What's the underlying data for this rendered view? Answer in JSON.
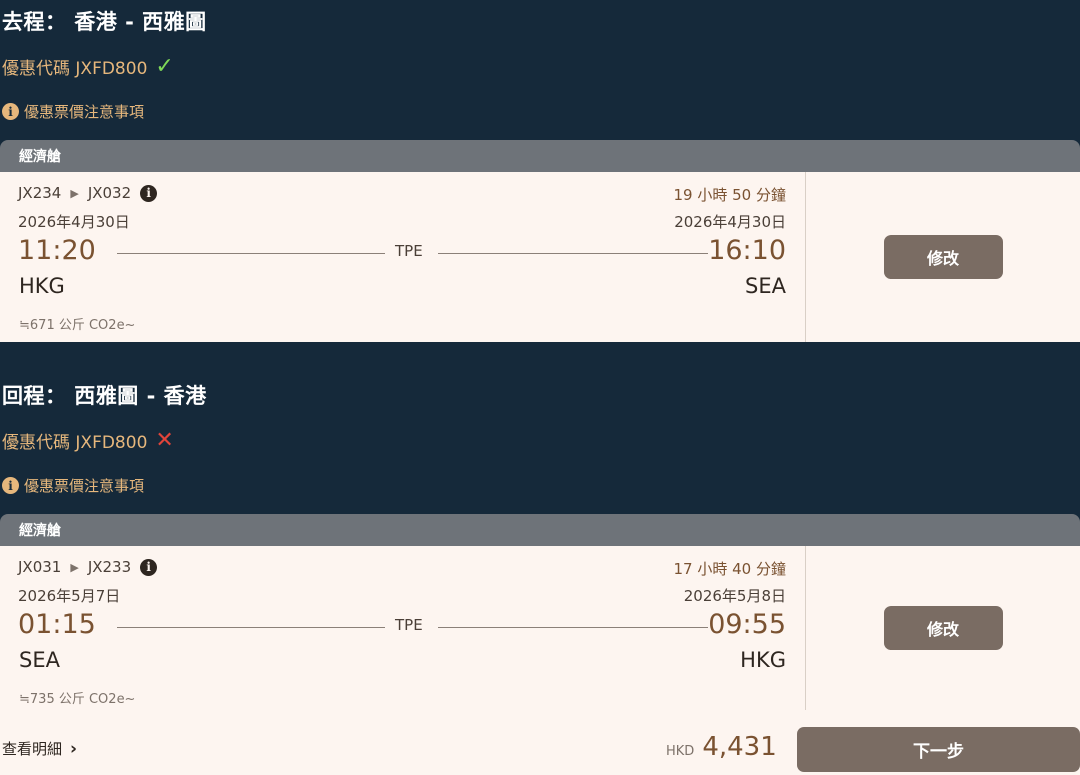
{
  "outbound": {
    "title": "去程： 香港 - 西雅圖",
    "promo_label": "優惠代碼 JXFD800",
    "promo_status": "✓",
    "notice": "優惠票價注意事項",
    "cabin": "經濟艙",
    "flight_1": "JX234",
    "flight_sep": "▶",
    "flight_2": "JX032",
    "duration": "19 小時 50 分鐘",
    "depart_date": "2026年4月30日",
    "arrive_date": "2026年4月30日",
    "depart_time": "11:20",
    "arrive_time": "16:10",
    "via": "TPE",
    "depart_code": "HKG",
    "arrive_code": "SEA",
    "co2": "≒671 公斤 CO2e~",
    "modify_label": "修改"
  },
  "return": {
    "title": "回程： 西雅圖 - 香港",
    "promo_label": "優惠代碼 JXFD800",
    "promo_status": "✕",
    "notice": "優惠票價注意事項",
    "cabin": "經濟艙",
    "flight_1": "JX031",
    "flight_sep": "▶",
    "flight_2": "JX233",
    "duration": "17 小時 40 分鐘",
    "depart_date": "2026年5月7日",
    "arrive_date": "2026年5月8日",
    "depart_time": "01:15",
    "arrive_time": "09:55",
    "via": "TPE",
    "depart_code": "SEA",
    "arrive_code": "HKG",
    "co2": "≒735 公斤 CO2e~",
    "modify_label": "修改"
  },
  "footer": {
    "details_label": "查看明細",
    "details_chevron": "›",
    "currency": "HKD",
    "amount": "4,431",
    "next_label": "下一步"
  },
  "icons": {
    "info": "i",
    "info_color": "#e6b77c",
    "promo_ok_color": "#7ed957",
    "promo_bad_color": "#e0443a"
  },
  "colors": {
    "background": "#15293a",
    "accent_gold": "#e6b77c",
    "button": "#7a6c63",
    "card": "#fdf5f0",
    "cabin_bar": "#6e7379"
  }
}
